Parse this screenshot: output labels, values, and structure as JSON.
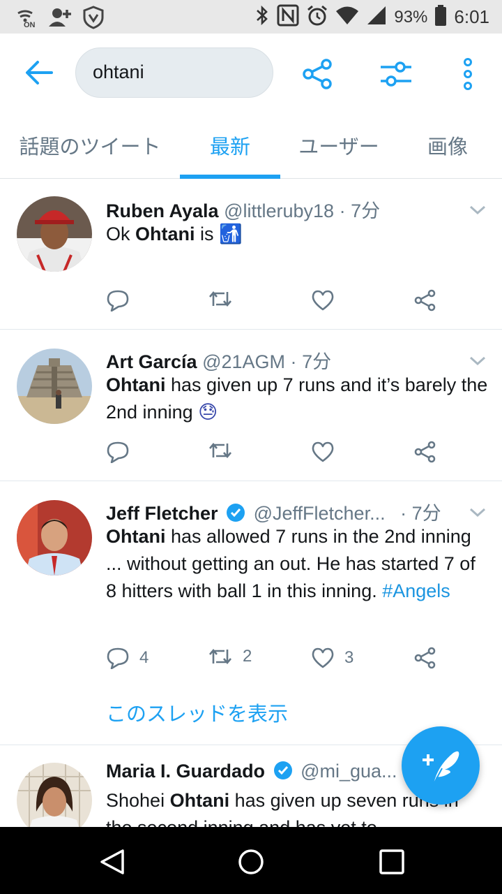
{
  "status_bar": {
    "battery": "93%",
    "time": "6:01",
    "nfc_label": "ON"
  },
  "search": {
    "query": "ohtani"
  },
  "tabs": [
    {
      "label": "話題のツイート"
    },
    {
      "label": "最新"
    },
    {
      "label": "ユーザー"
    },
    {
      "label": "画像"
    }
  ],
  "tweets": [
    {
      "name": "Ruben Ayala",
      "handle": "@littleruby18",
      "sep": "·",
      "time": "7分",
      "text_parts": {
        "before": "Ok ",
        "bold": "Ohtani",
        "after": " is "
      },
      "emoji": "🚮"
    },
    {
      "name": "Art García",
      "handle": "@21AGM",
      "sep": "·",
      "time": "7分",
      "text_parts": {
        "bold": "Ohtani",
        "after": " has given up 7 runs and it’s barely the 2nd inning "
      },
      "emoji": "😓"
    },
    {
      "name": "Jeff Fletcher",
      "handle": "@JeffFletcher...",
      "sep": "·",
      "time": "7分",
      "text_parts": {
        "bold": "Ohtani",
        "after": " has allowed 7 runs in the 2nd inning ... without getting an out. He has started 7 of 8 hitters with ball 1 in this inning. "
      },
      "hashtag": "#Angels",
      "replies": "4",
      "retweets": "2",
      "likes": "3",
      "thread_link": "このスレッドを表示"
    },
    {
      "name": "Maria I. Guardado",
      "handle": "@mi_gua...",
      "text_parts": {
        "before": "Shohei ",
        "bold": "Ohtani",
        "after": " has given up seven runs in the second inning and has yet to"
      }
    }
  ],
  "colors": {
    "accent": "#1da1f2",
    "text_secondary": "#657786",
    "status_bar_bg": "#e8e8e8"
  }
}
